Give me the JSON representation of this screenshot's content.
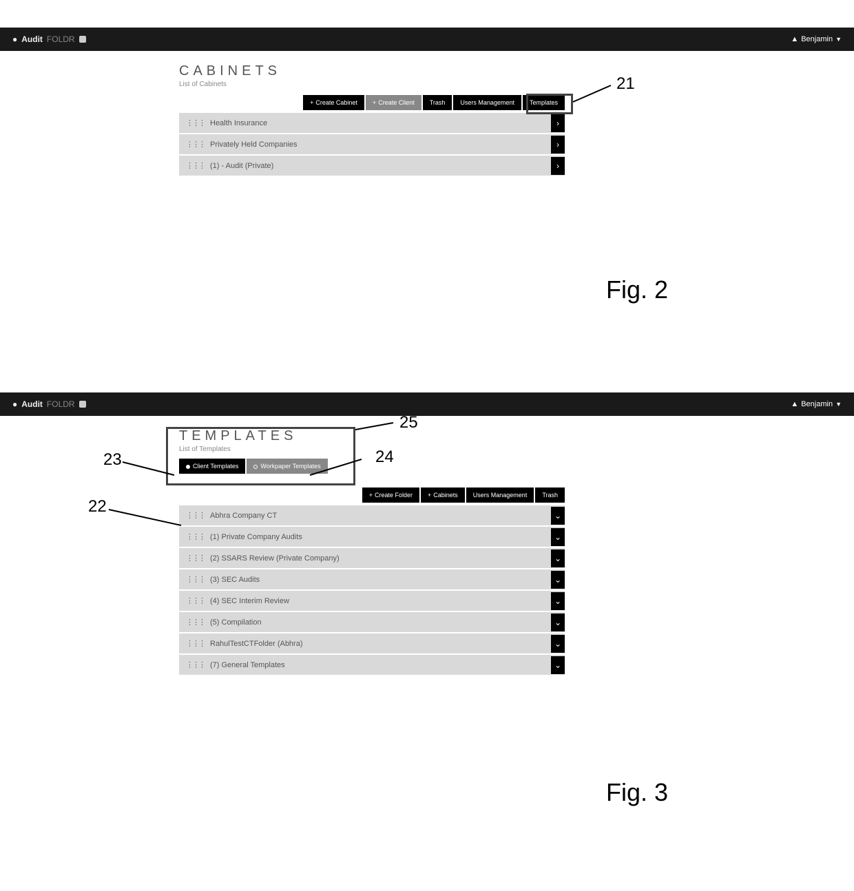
{
  "topbar": {
    "brand_a": "Audit",
    "brand_b": "FOLDR",
    "user": "Benjamin"
  },
  "fig2": {
    "title": "CABINETS",
    "subtitle": "List of Cabinets",
    "buttons": {
      "create_cabinet": "Create Cabinet",
      "create_client": "Create Client",
      "trash": "Trash",
      "users_mgmt": "Users Management",
      "templates": "Templates"
    },
    "rows": [
      "Health Insurance",
      "Privately Held Companies",
      "(1) - Audit (Private)"
    ],
    "callouts": {
      "c21": "21"
    },
    "label": "Fig. 2"
  },
  "fig3": {
    "title": "TEMPLATES",
    "subtitle": "List of Templates",
    "tab_buttons": {
      "client_templates": "Client Templates",
      "workpaper_templates": "Workpaper Templates"
    },
    "buttons": {
      "create_folder": "Create Folder",
      "cabinets": "Cabinets",
      "users_mgmt": "Users Management",
      "trash": "Trash"
    },
    "rows": [
      "Abhra Company CT",
      "(1) Private Company Audits",
      "(2) SSARS Review (Private Company)",
      "(3) SEC Audits",
      "(4) SEC Interim Review",
      "(5) Compilation",
      "RahulTestCTFolder (Abhra)",
      "(7) General Templates"
    ],
    "callouts": {
      "c22": "22",
      "c23": "23",
      "c24": "24",
      "c25": "25"
    },
    "label": "Fig. 3"
  }
}
